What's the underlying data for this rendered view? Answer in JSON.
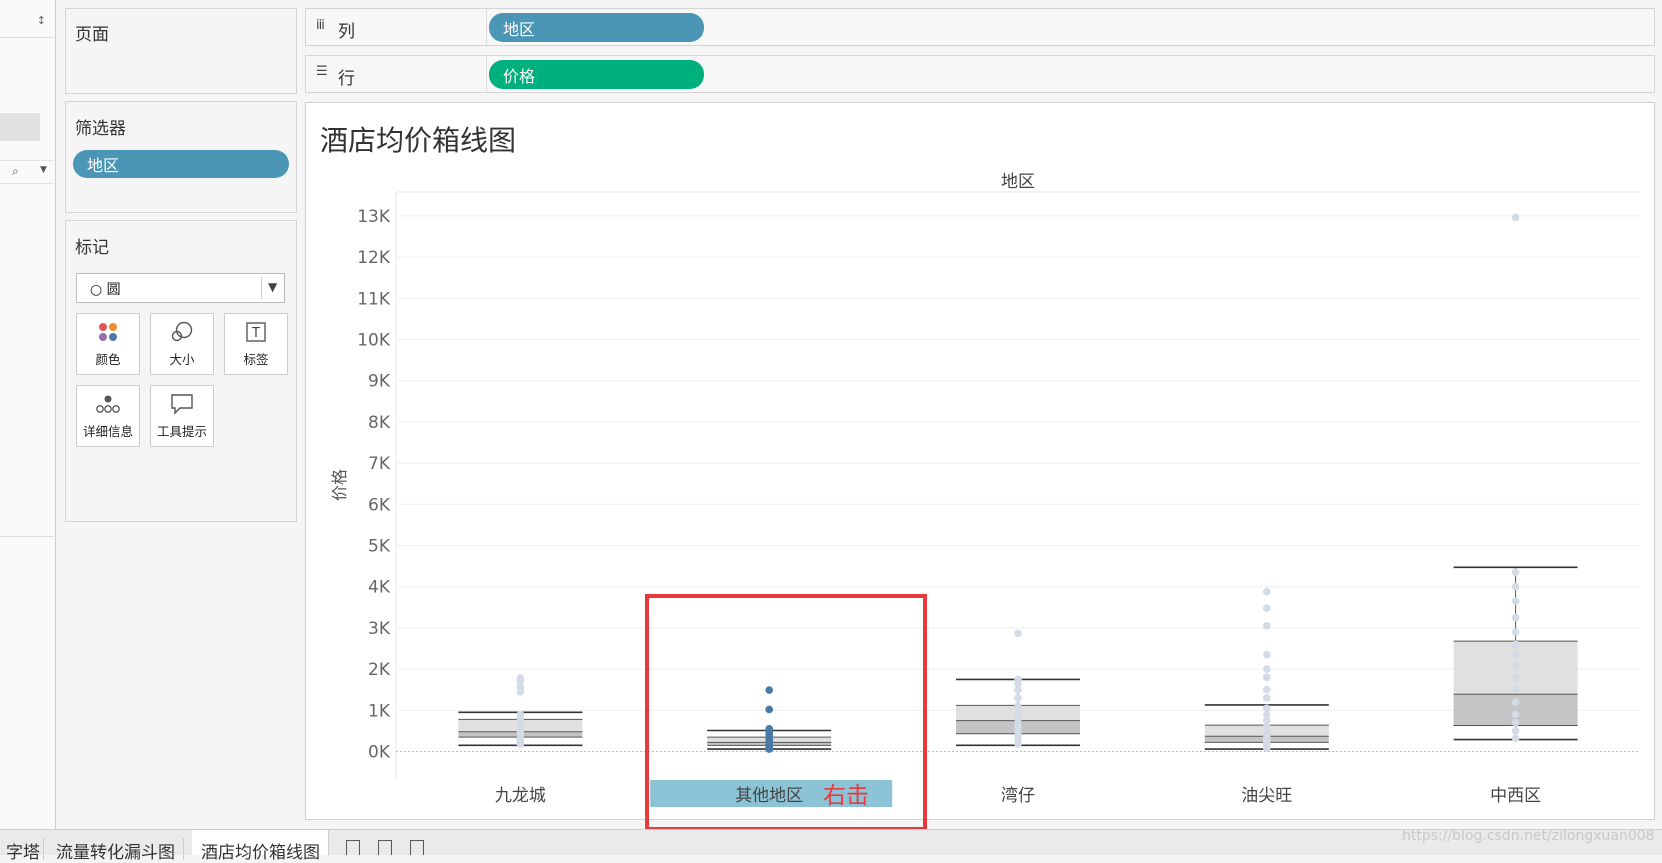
{
  "left_strip": {
    "updown_glyph": "↕"
  },
  "pages_panel": {
    "title": "页面"
  },
  "filters_panel": {
    "title": "筛选器",
    "pill": "地区"
  },
  "marks_panel": {
    "title": "标记",
    "mark_type": "○ 圆",
    "cards": [
      {
        "label": "颜色",
        "icon": "color-dots-icon"
      },
      {
        "label": "大小",
        "icon": "size-circles-icon"
      },
      {
        "label": "标签",
        "icon": "label-t-icon"
      },
      {
        "label": "详细信息",
        "icon": "detail-dots-icon"
      },
      {
        "label": "工具提示",
        "icon": "tooltip-bubble-icon"
      }
    ]
  },
  "shelves": {
    "columns": {
      "label": "列",
      "icon_glyph": "iii",
      "pill": "地区"
    },
    "rows": {
      "label": "行",
      "icon_glyph": "☰",
      "pill": "价格"
    }
  },
  "colors": {
    "dimension_pill": "#4b95b5",
    "measure_pill": "#00b07c",
    "highlight_band": "#8cc3d6",
    "annotation_red": "#e8393c",
    "selected_point": "#4a79a8",
    "faded_point": "#d3dbe6"
  },
  "worksheet": {
    "title": "酒店均价箱线图",
    "annotation": "右击"
  },
  "chart_data": {
    "type": "box",
    "title": "",
    "column_header": "地区",
    "xlabel": "",
    "ylabel": "价格",
    "categories": [
      "九龙城",
      "其他地区",
      "湾仔",
      "油尖旺",
      "中西区"
    ],
    "yticks": [
      "0K",
      "1K",
      "2K",
      "3K",
      "4K",
      "5K",
      "6K",
      "7K",
      "8K",
      "9K",
      "10K",
      "11K",
      "12K",
      "13K"
    ],
    "ylim": [
      -600,
      13550
    ],
    "grid": true,
    "highlighted_category": "其他地区",
    "boxes": [
      {
        "category": "九龙城",
        "whisker_low": 150,
        "q1": 350,
        "median": 480,
        "q3": 780,
        "whisker_high": 950,
        "points": [
          180,
          230,
          280,
          320,
          400,
          450,
          500,
          600,
          700,
          800,
          900,
          1450,
          1560,
          1700,
          1780
        ]
      },
      {
        "category": "其他地区",
        "whisker_low": 60,
        "q1": 150,
        "median": 220,
        "q3": 350,
        "whisker_high": 510,
        "points": [
          60,
          90,
          110,
          140,
          170,
          200,
          240,
          280,
          320,
          380,
          430,
          480,
          550,
          1020,
          1490
        ]
      },
      {
        "category": "湾仔",
        "whisker_low": 150,
        "q1": 430,
        "median": 750,
        "q3": 1120,
        "whisker_high": 1750,
        "points": [
          180,
          300,
          400,
          500,
          600,
          700,
          800,
          950,
          1100,
          1300,
          1500,
          1650,
          1750,
          2870
        ]
      },
      {
        "category": "油尖旺",
        "whisker_low": 60,
        "q1": 220,
        "median": 370,
        "q3": 640,
        "whisker_high": 1130,
        "points": [
          80,
          150,
          200,
          260,
          330,
          400,
          500,
          600,
          750,
          900,
          1050,
          1300,
          1500,
          1800,
          2000,
          2350,
          3050,
          3480,
          3880
        ]
      },
      {
        "category": "中西区",
        "whisker_low": 290,
        "q1": 630,
        "median": 1390,
        "q3": 2680,
        "whisker_high": 4470,
        "points": [
          320,
          500,
          700,
          900,
          1200,
          1500,
          1800,
          2100,
          2350,
          2600,
          2900,
          3250,
          3650,
          4000,
          4350,
          12960
        ]
      }
    ]
  },
  "bottom_tabs": [
    "字塔",
    "流量转化漏斗图",
    "酒店均价箱线图"
  ],
  "watermark": "https://blog.csdn.net/zilongxuan008"
}
